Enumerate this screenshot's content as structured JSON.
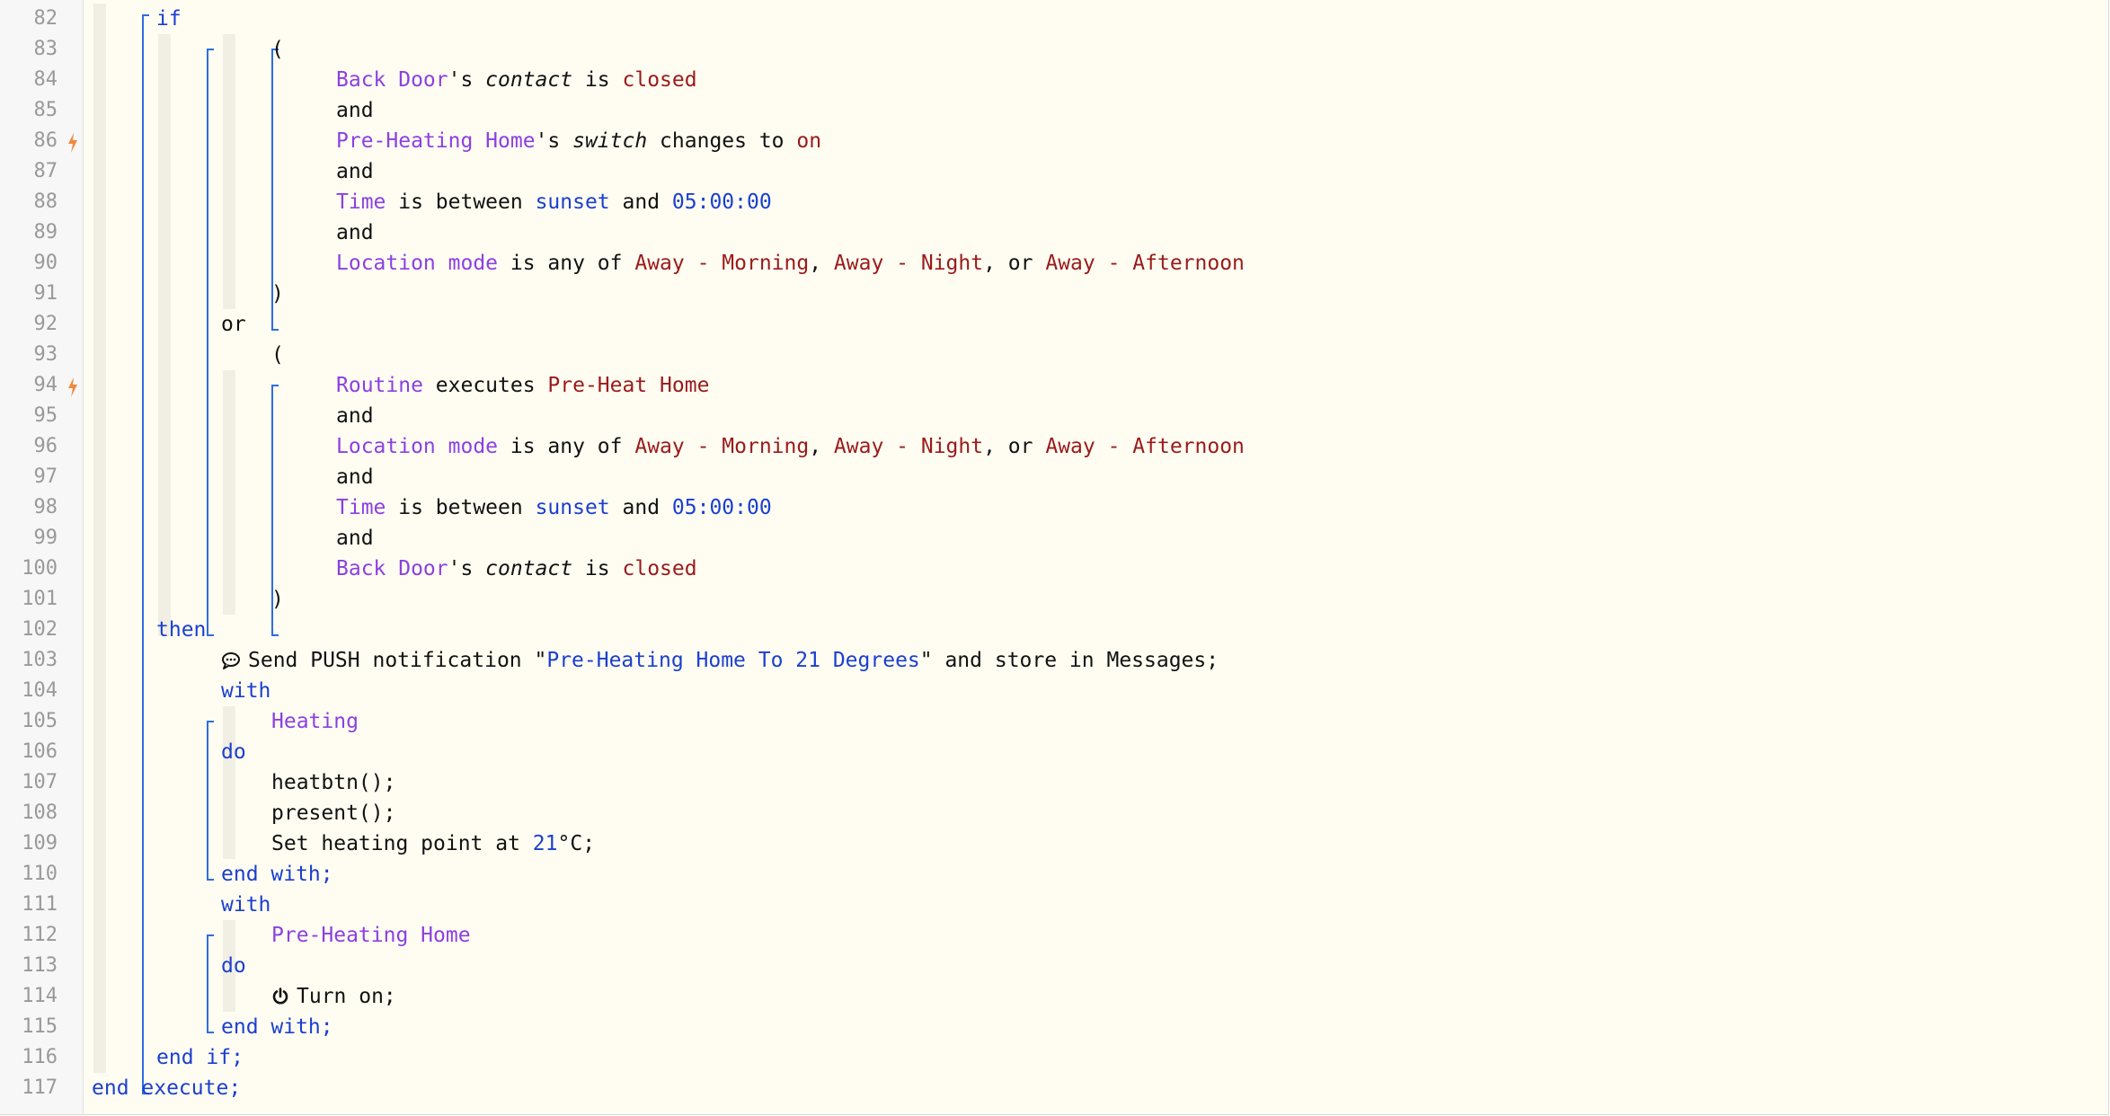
{
  "lines": [
    {
      "num": "82",
      "trig": false,
      "indent": 0,
      "segs": [
        {
          "t": "if",
          "c": "kw"
        }
      ]
    },
    {
      "num": "83",
      "trig": false,
      "indent": 2,
      "segs": [
        {
          "t": "(",
          "c": ""
        }
      ]
    },
    {
      "num": "84",
      "trig": false,
      "indent": 3,
      "segs": [
        {
          "t": "Back Door",
          "c": "dev"
        },
        {
          "t": "'s ",
          "c": ""
        },
        {
          "t": "contact",
          "c": "attr"
        },
        {
          "t": " is ",
          "c": ""
        },
        {
          "t": "closed",
          "c": "val"
        }
      ]
    },
    {
      "num": "85",
      "trig": false,
      "indent": 3,
      "segs": [
        {
          "t": "and",
          "c": ""
        }
      ]
    },
    {
      "num": "86",
      "trig": true,
      "indent": 3,
      "segs": [
        {
          "t": "Pre-Heating Home",
          "c": "dev"
        },
        {
          "t": "'s ",
          "c": ""
        },
        {
          "t": "switch",
          "c": "attr"
        },
        {
          "t": " changes to ",
          "c": ""
        },
        {
          "t": "on",
          "c": "val"
        }
      ]
    },
    {
      "num": "87",
      "trig": false,
      "indent": 3,
      "segs": [
        {
          "t": "and",
          "c": ""
        }
      ]
    },
    {
      "num": "88",
      "trig": false,
      "indent": 3,
      "segs": [
        {
          "t": "Time",
          "c": "dev"
        },
        {
          "t": " is between ",
          "c": ""
        },
        {
          "t": "sunset",
          "c": "num"
        },
        {
          "t": " and ",
          "c": ""
        },
        {
          "t": "05:00:00",
          "c": "num"
        }
      ]
    },
    {
      "num": "89",
      "trig": false,
      "indent": 3,
      "segs": [
        {
          "t": "and",
          "c": ""
        }
      ]
    },
    {
      "num": "90",
      "trig": false,
      "indent": 3,
      "segs": [
        {
          "t": "Location mode",
          "c": "dev"
        },
        {
          "t": " is any of ",
          "c": ""
        },
        {
          "t": "Away - Morning",
          "c": "val"
        },
        {
          "t": ", ",
          "c": ""
        },
        {
          "t": "Away - Night",
          "c": "val"
        },
        {
          "t": ", or ",
          "c": ""
        },
        {
          "t": "Away - Afternoon",
          "c": "val"
        }
      ]
    },
    {
      "num": "91",
      "trig": false,
      "indent": 2,
      "segs": [
        {
          "t": ")",
          "c": ""
        }
      ]
    },
    {
      "num": "92",
      "trig": false,
      "indent": 1,
      "segs": [
        {
          "t": "or",
          "c": ""
        }
      ]
    },
    {
      "num": "93",
      "trig": false,
      "indent": 2,
      "segs": [
        {
          "t": "(",
          "c": ""
        }
      ]
    },
    {
      "num": "94",
      "trig": true,
      "indent": 3,
      "segs": [
        {
          "t": "Routine",
          "c": "dev"
        },
        {
          "t": " executes ",
          "c": ""
        },
        {
          "t": "Pre-Heat Home",
          "c": "val"
        }
      ]
    },
    {
      "num": "95",
      "trig": false,
      "indent": 3,
      "segs": [
        {
          "t": "and",
          "c": ""
        }
      ]
    },
    {
      "num": "96",
      "trig": false,
      "indent": 3,
      "segs": [
        {
          "t": "Location mode",
          "c": "dev"
        },
        {
          "t": " is any of ",
          "c": ""
        },
        {
          "t": "Away - Morning",
          "c": "val"
        },
        {
          "t": ", ",
          "c": ""
        },
        {
          "t": "Away - Night",
          "c": "val"
        },
        {
          "t": ", or ",
          "c": ""
        },
        {
          "t": "Away - Afternoon",
          "c": "val"
        }
      ]
    },
    {
      "num": "97",
      "trig": false,
      "indent": 3,
      "segs": [
        {
          "t": "and",
          "c": ""
        }
      ]
    },
    {
      "num": "98",
      "trig": false,
      "indent": 3,
      "segs": [
        {
          "t": "Time",
          "c": "dev"
        },
        {
          "t": " is between ",
          "c": ""
        },
        {
          "t": "sunset",
          "c": "num"
        },
        {
          "t": " and ",
          "c": ""
        },
        {
          "t": "05:00:00",
          "c": "num"
        }
      ]
    },
    {
      "num": "99",
      "trig": false,
      "indent": 3,
      "segs": [
        {
          "t": "and",
          "c": ""
        }
      ]
    },
    {
      "num": "100",
      "trig": false,
      "indent": 3,
      "segs": [
        {
          "t": "Back Door",
          "c": "dev"
        },
        {
          "t": "'s ",
          "c": ""
        },
        {
          "t": "contact",
          "c": "attr"
        },
        {
          "t": " is ",
          "c": ""
        },
        {
          "t": "closed",
          "c": "val"
        }
      ]
    },
    {
      "num": "101",
      "trig": false,
      "indent": 2,
      "segs": [
        {
          "t": ")",
          "c": ""
        }
      ]
    },
    {
      "num": "102",
      "trig": false,
      "indent": 0,
      "segs": [
        {
          "t": "then",
          "c": "kw"
        }
      ]
    },
    {
      "num": "103",
      "trig": false,
      "indent": 1,
      "icon": "comment-icon",
      "segs": [
        {
          "t": "Send PUSH notification \"",
          "c": ""
        },
        {
          "t": "Pre-Heating Home To 21 Degrees",
          "c": "str"
        },
        {
          "t": "\" and store in Messages;",
          "c": ""
        }
      ]
    },
    {
      "num": "104",
      "trig": false,
      "indent": 1,
      "segs": [
        {
          "t": "with",
          "c": "kw"
        }
      ]
    },
    {
      "num": "105",
      "trig": false,
      "indent": 2,
      "segs": [
        {
          "t": "Heating",
          "c": "dev"
        }
      ]
    },
    {
      "num": "106",
      "trig": false,
      "indent": 1,
      "segs": [
        {
          "t": "do",
          "c": "kw"
        }
      ]
    },
    {
      "num": "107",
      "trig": false,
      "indent": 2,
      "segs": [
        {
          "t": "heatbtn();",
          "c": ""
        }
      ]
    },
    {
      "num": "108",
      "trig": false,
      "indent": 2,
      "segs": [
        {
          "t": "present();",
          "c": ""
        }
      ]
    },
    {
      "num": "109",
      "trig": false,
      "indent": 2,
      "segs": [
        {
          "t": "Set heating point at ",
          "c": ""
        },
        {
          "t": "21",
          "c": "num"
        },
        {
          "t": "°C;",
          "c": ""
        }
      ]
    },
    {
      "num": "110",
      "trig": false,
      "indent": 1,
      "segs": [
        {
          "t": "end with;",
          "c": "kw"
        }
      ]
    },
    {
      "num": "111",
      "trig": false,
      "indent": 1,
      "segs": [
        {
          "t": "with",
          "c": "kw"
        }
      ]
    },
    {
      "num": "112",
      "trig": false,
      "indent": 2,
      "segs": [
        {
          "t": "Pre-Heating Home",
          "c": "dev"
        }
      ]
    },
    {
      "num": "113",
      "trig": false,
      "indent": 1,
      "segs": [
        {
          "t": "do",
          "c": "kw"
        }
      ]
    },
    {
      "num": "114",
      "trig": false,
      "indent": 2,
      "icon": "power-icon",
      "segs": [
        {
          "t": "Turn on;",
          "c": ""
        }
      ]
    },
    {
      "num": "115",
      "trig": false,
      "indent": 1,
      "segs": [
        {
          "t": "end with;",
          "c": "kw"
        }
      ]
    },
    {
      "num": "116",
      "trig": false,
      "indent": 0,
      "segs": [
        {
          "t": "end if;",
          "c": "kw"
        }
      ]
    },
    {
      "num": "117",
      "trig": false,
      "indent": -1,
      "segs": [
        {
          "t": "end execute;",
          "c": "kw"
        }
      ]
    }
  ],
  "colors": {
    "keyword": "#1a3fcf",
    "device": "#8c3fe2",
    "value": "#9a1a1a",
    "trigger": "#f0883e",
    "bracket": "#2d6ee0",
    "background": "#fffdf2"
  }
}
